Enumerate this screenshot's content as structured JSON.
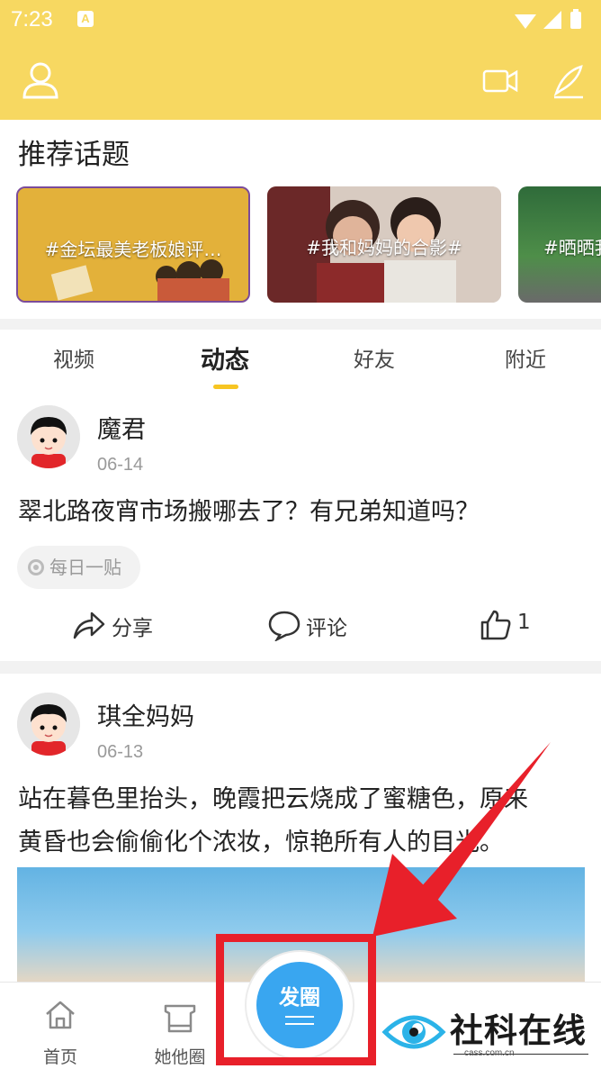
{
  "status_bar": {
    "time": "7:23",
    "app_badge": "A"
  },
  "header": {
    "left_icon": "user-icon",
    "right_icons": [
      "video-camera-icon",
      "pen-icon"
    ],
    "background": "#f7d861"
  },
  "topics": {
    "title": "推荐话题",
    "cards": [
      {
        "label": "#金坛最美老板娘评…"
      },
      {
        "label": "#我和妈妈的合影#"
      },
      {
        "label": "#晒晒我"
      }
    ]
  },
  "tabs": [
    {
      "label": "视频",
      "active": false
    },
    {
      "label": "动态",
      "active": true
    },
    {
      "label": "好友",
      "active": false
    },
    {
      "label": "附近",
      "active": false
    }
  ],
  "posts": [
    {
      "username": "魔君",
      "date": "06-14",
      "text": "翠北路夜宵市场搬哪去了？有兄弟知道吗？",
      "tag": "每日一贴",
      "actions": {
        "share": "分享",
        "comment": "评论",
        "like_count": "1"
      }
    },
    {
      "username": "琪全妈妈",
      "date": "06-13",
      "text_line1": "站在暮色里抬头，晚霞把云烧成了蜜糖色，原来",
      "text_line2": "黄昏也会偷偷化个浓妆，惊艳所有人的目光。"
    }
  ],
  "bottom_nav": {
    "home": "首页",
    "circle": "她他圈",
    "publish": "发圈"
  },
  "watermark": {
    "title": "社科在线",
    "url": "cass.com.cn"
  },
  "colors": {
    "accent": "#f7c522",
    "fab": "#39a6f0",
    "annotation": "#e8202a"
  }
}
